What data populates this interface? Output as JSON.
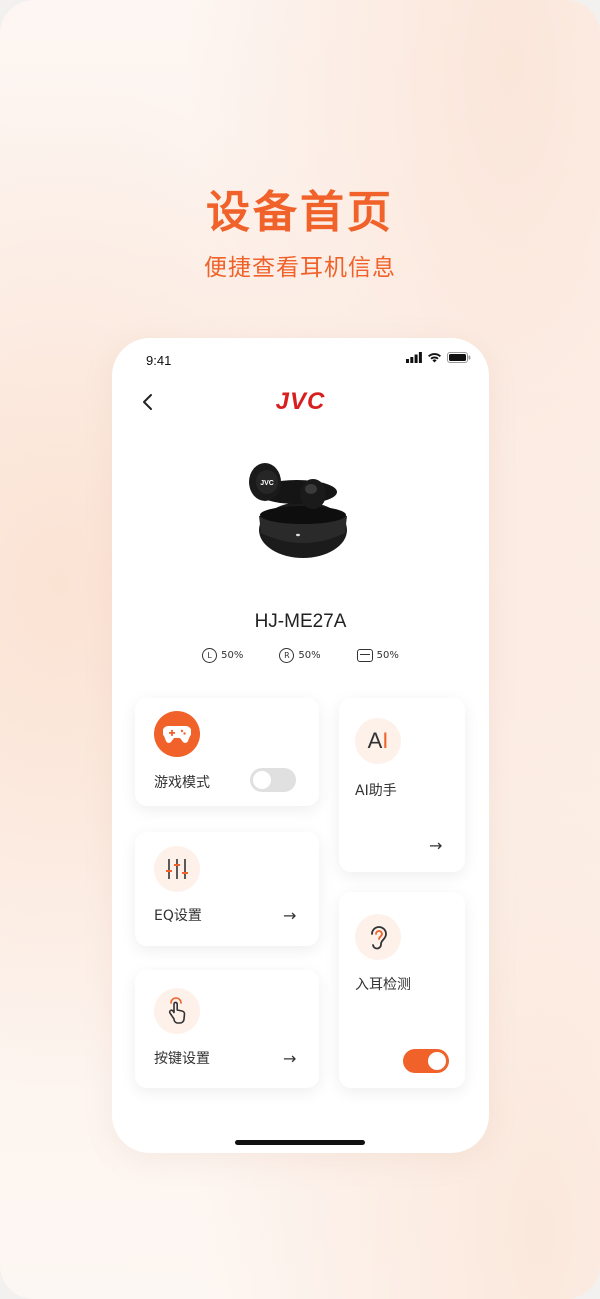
{
  "hero": {
    "title": "设备首页",
    "subtitle": "便捷查看耳机信息"
  },
  "status_bar": {
    "time": "9:41"
  },
  "header": {
    "logo": "JVC"
  },
  "device": {
    "model": "HJ-ME27A",
    "battery": [
      {
        "label": "L",
        "value": "50%"
      },
      {
        "label": "R",
        "value": "50%"
      },
      {
        "label": "case",
        "value": "50%"
      }
    ]
  },
  "cards": {
    "game_mode": {
      "label": "游戏模式",
      "enabled": false
    },
    "ai_assistant": {
      "label": "AI助手",
      "icon_text": "AI"
    },
    "eq": {
      "label": "EQ设置"
    },
    "in_ear": {
      "label": "入耳检测",
      "enabled": true
    },
    "keys": {
      "label": "按键设置"
    }
  },
  "colors": {
    "accent": "#f0622a",
    "logo_red": "#d81e1e",
    "toggle_off": "#e0e0e0"
  }
}
